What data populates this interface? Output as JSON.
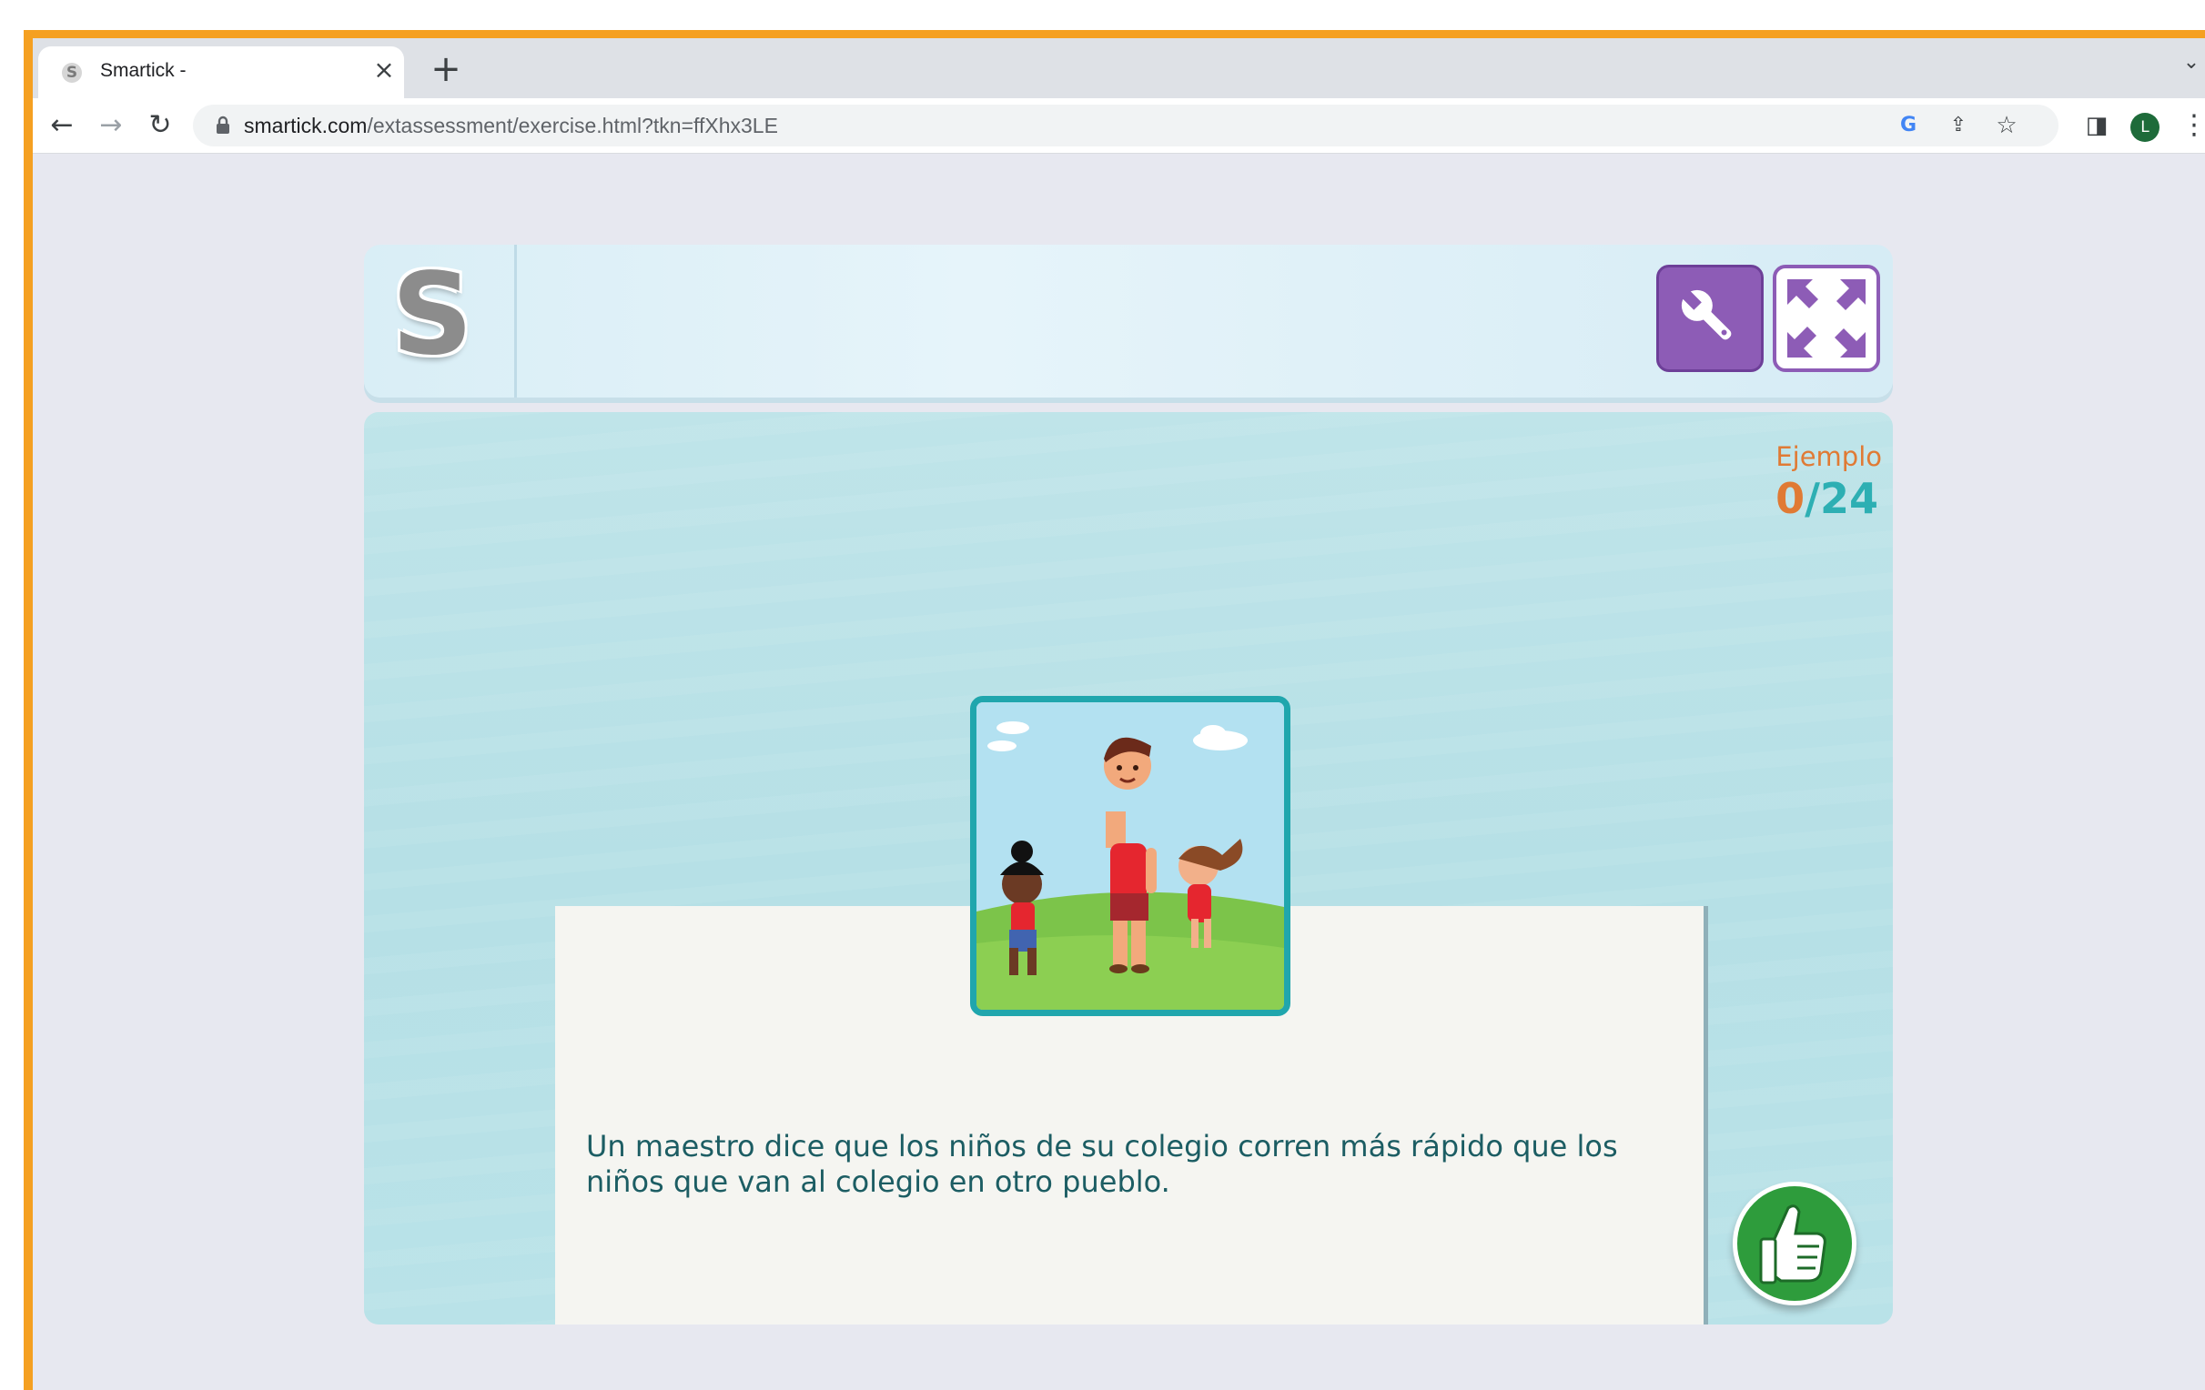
{
  "browser": {
    "tab": {
      "title": "Smartick -",
      "favicon": "S",
      "close_icon": "×"
    },
    "new_tab_icon": "+",
    "tab_menu_icon": "⌄",
    "url_domain": "smartick.com",
    "url_path": "/extassessment/exercise.html?tkn=ffXhx3LE",
    "profile_initial": "L",
    "icons": {
      "back": "←",
      "forward": "→",
      "reload": "↻",
      "google": "G",
      "share": "⇪",
      "star": "☆",
      "sidepanel": "◨",
      "menu": "⋮"
    }
  },
  "app": {
    "logo_letter": "S",
    "counter_label": "Ejemplo",
    "counter_current": "0",
    "counter_separator": "/",
    "counter_total": "24",
    "prompt_text": "Un maestro dice que los niños de su colegio corren más rápido que los niños que van al colegio en otro pueblo.",
    "colors": {
      "accent_purple": "#8d5cb6",
      "accent_teal": "#20a6ad",
      "counter_orange": "#e07a34",
      "confirm_green": "#2e9c3c"
    }
  }
}
